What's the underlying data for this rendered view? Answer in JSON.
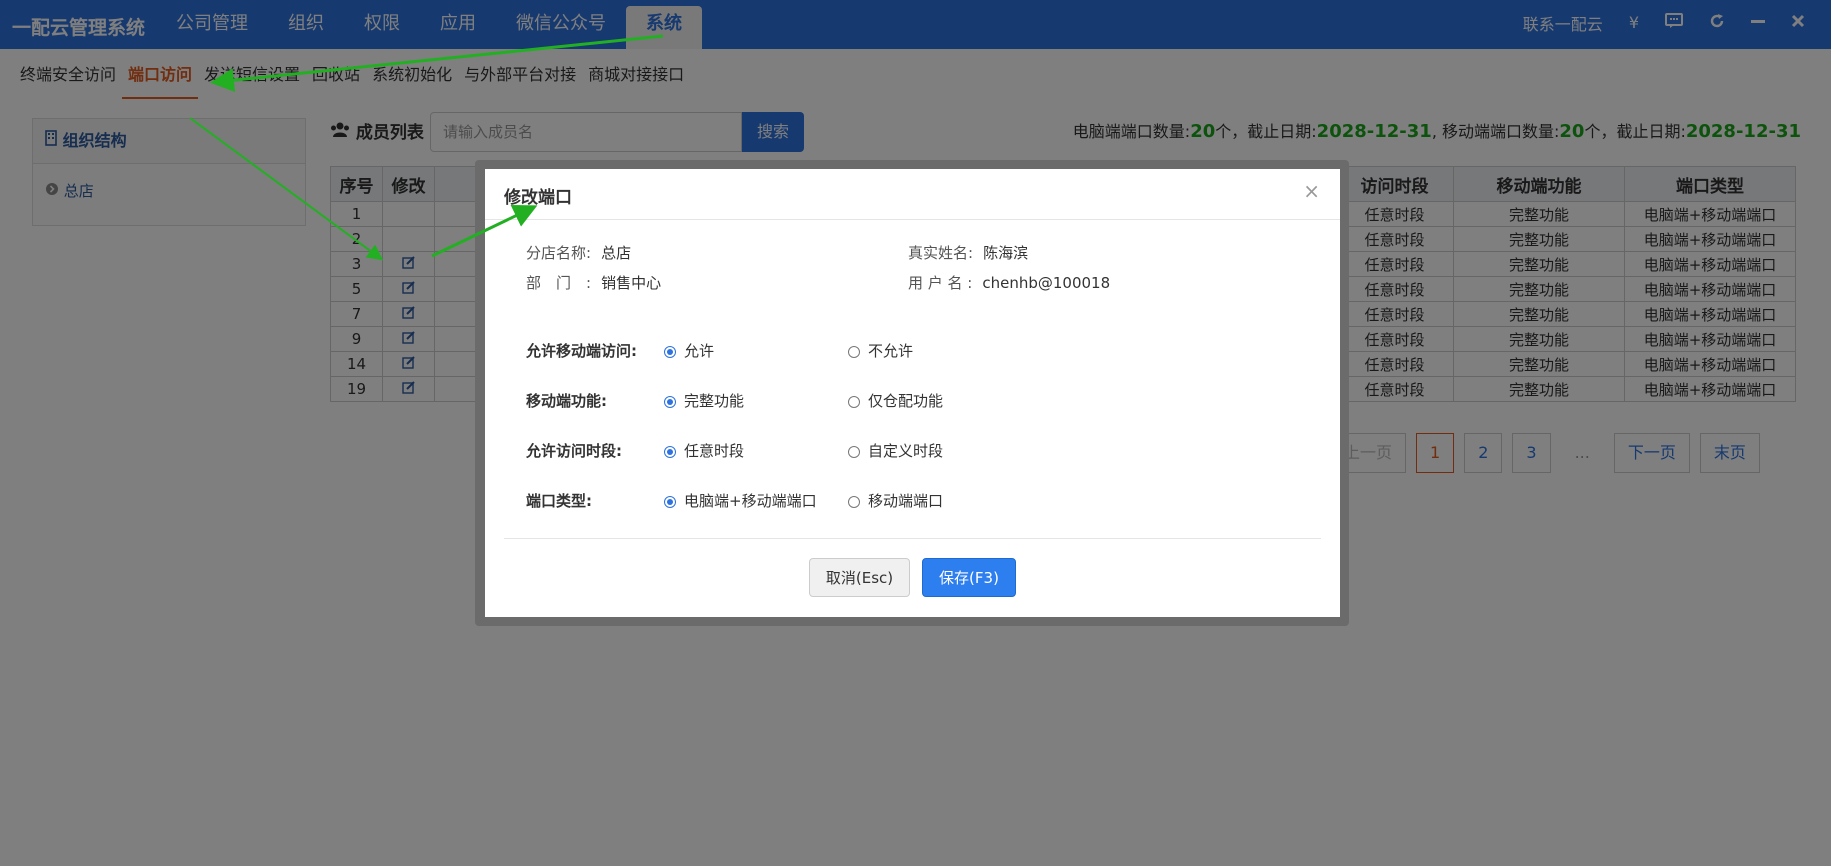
{
  "app": {
    "title": "一配云管理系统"
  },
  "topnav": {
    "items": [
      "公司管理",
      "组织",
      "权限",
      "应用",
      "微信公众号",
      "系统"
    ],
    "active": "系统"
  },
  "topright": {
    "contact": "联系一配云",
    "yuan_icon": "¥"
  },
  "subnav": {
    "items": [
      "终端安全访问",
      "端口访问",
      "发送短信设置",
      "回收站",
      "系统初始化",
      "与外部平台对接",
      "商城对接接口"
    ],
    "active": "端口访问"
  },
  "org": {
    "title": "组织结构",
    "node": "总店"
  },
  "members": {
    "label": "成员列表",
    "search_placeholder": "请输入成员名",
    "search_button": "搜索"
  },
  "port_info": {
    "pc_label": "电脑端端口数量:",
    "pc_count": "20",
    "unit1": "个，截止日期:",
    "pc_date": "2028-12-31",
    "mobile_label": ", 移动端端口数量:",
    "mobile_count": "20",
    "unit2": "个，截止日期:",
    "mobile_date": "2028-12-31"
  },
  "table": {
    "headers": [
      "序号",
      "修改",
      "访问时段",
      "移动端功能",
      "端口类型"
    ],
    "rows": [
      {
        "no": "1",
        "time": "任意时段",
        "func": "完整功能",
        "type": "电脑端+移动端端口"
      },
      {
        "no": "2",
        "time": "任意时段",
        "func": "完整功能",
        "type": "电脑端+移动端端口"
      },
      {
        "no": "3",
        "time": "任意时段",
        "func": "完整功能",
        "type": "电脑端+移动端端口"
      },
      {
        "no": "5",
        "time": "任意时段",
        "func": "完整功能",
        "type": "电脑端+移动端端口"
      },
      {
        "no": "7",
        "time": "任意时段",
        "func": "完整功能",
        "type": "电脑端+移动端端口"
      },
      {
        "no": "9",
        "time": "任意时段",
        "func": "完整功能",
        "type": "电脑端+移动端端口"
      },
      {
        "no": "14",
        "time": "任意时段",
        "func": "完整功能",
        "type": "电脑端+移动端端口"
      },
      {
        "no": "19",
        "time": "任意时段",
        "func": "完整功能",
        "type": "电脑端+移动端端口"
      }
    ]
  },
  "pager": {
    "prev": "上一页",
    "pages": [
      "1",
      "2",
      "3"
    ],
    "ellipsis": "...",
    "next": "下一页",
    "last": "末页",
    "current": "1"
  },
  "dialog": {
    "title": "修改端口",
    "close": "×",
    "branch_label": "分店名称:",
    "branch_value": "总店",
    "dept_label": "部　门　:",
    "dept_value": "销售中心",
    "realname_label": "真实姓名:",
    "realname_value": "陈海滨",
    "username_label": "用 户 名 :",
    "username_value": "chenhb@100018",
    "fields": [
      {
        "label": "允许移动端访问:",
        "opt1": "允许",
        "opt2": "不允许",
        "selected": 1
      },
      {
        "label": "移动端功能:",
        "opt1": "完整功能",
        "opt2": "仅仓配功能",
        "selected": 1
      },
      {
        "label": "允许访问时段:",
        "opt1": "任意时段",
        "opt2": "自定义时段",
        "selected": 1
      },
      {
        "label": "端口类型:",
        "opt1": "电脑端+移动端端口",
        "opt2": "移动端端口",
        "selected": 1
      }
    ],
    "cancel": "取消(Esc)",
    "save": "保存(F3)"
  },
  "colors": {
    "primary": "#2d72e0",
    "accent": "#e35a1e",
    "green": "#1aa51a",
    "arrow": "#22b022"
  }
}
